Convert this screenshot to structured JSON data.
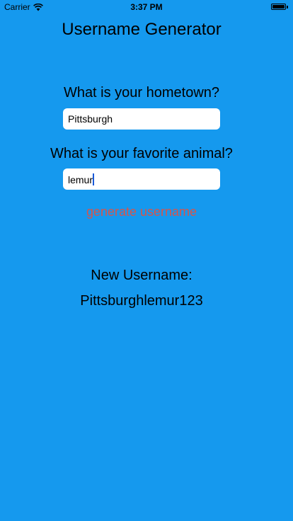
{
  "status_bar": {
    "carrier": "Carrier",
    "time": "3:37 PM",
    "wifi_icon": "wifi-icon",
    "battery_icon": "battery-icon",
    "battery_level": 1.0
  },
  "title": "Username Generator",
  "hometown": {
    "question": "What is your hometown?",
    "value": "Pittsburgh"
  },
  "animal": {
    "question": "What is your favorite animal?",
    "value": "lemur"
  },
  "generate_button": {
    "label": "generate username",
    "color": "#d6554c"
  },
  "result": {
    "label": "New Username:",
    "value": "Pittsburghlemur123"
  },
  "colors": {
    "background": "#1599ee",
    "caret": "#1a5ad8"
  }
}
